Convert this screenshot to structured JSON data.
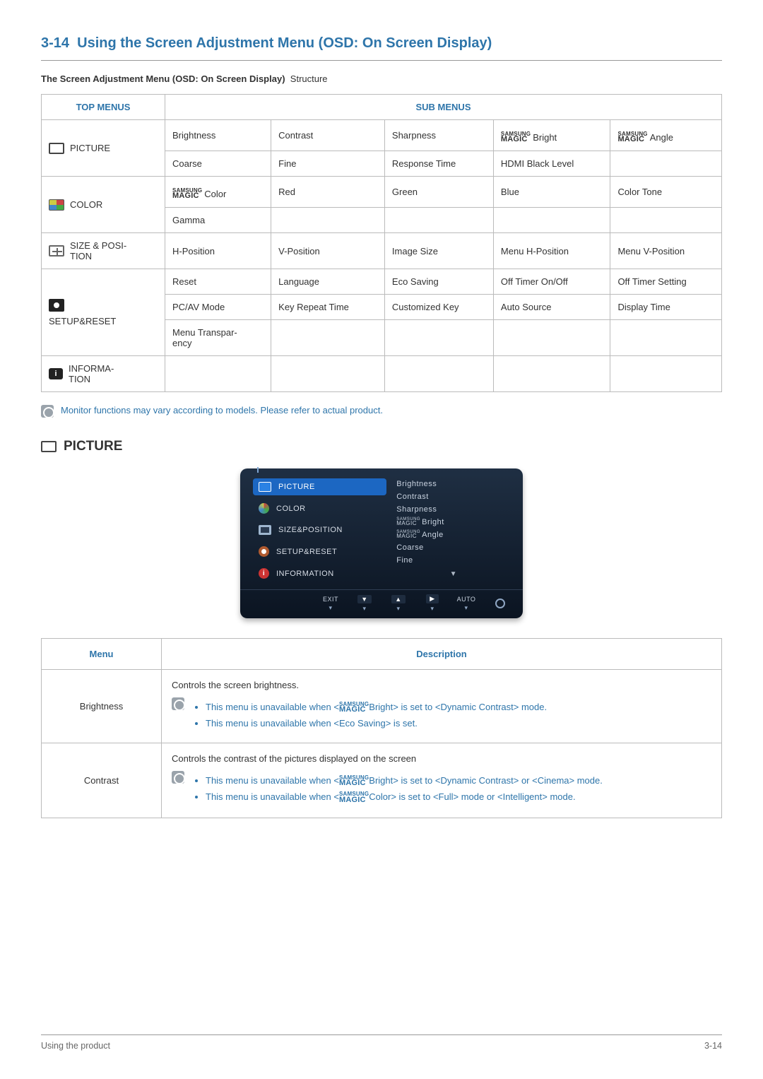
{
  "page": {
    "section_number": "3-14",
    "title": "Using the Screen Adjustment Menu (OSD: On Screen Display)",
    "subtitle_bold": "The Screen Adjustment Menu (OSD: On Screen Display)",
    "subtitle_rest": "Structure",
    "footer_left": "Using the product",
    "footer_right": "3-14"
  },
  "brand": {
    "samsung": "SAMSUNG",
    "magic": "MAGIC"
  },
  "top_table": {
    "header_left": "TOP MENUS",
    "header_right": "SUB MENUS",
    "rows": [
      {
        "menu": "PICTURE",
        "icon": "rect",
        "cells": [
          [
            "Brightness",
            "Contrast",
            "Sharpness",
            "{MAGIC} Bright",
            "{MAGIC} Angle"
          ],
          [
            "Coarse",
            "Fine",
            "Response Time",
            "HDMI Black Level",
            ""
          ]
        ]
      },
      {
        "menu": "COLOR",
        "icon": "color",
        "cells": [
          [
            "{MAGIC}Color",
            "Red",
            "Green",
            "Blue",
            "Color Tone"
          ],
          [
            "Gamma",
            "",
            "",
            "",
            ""
          ]
        ]
      },
      {
        "menu": "SIZE & POSI-TION",
        "icon": "sizepos",
        "cells": [
          [
            "H-Position",
            "V-Position",
            "Image Size",
            "Menu H-Position",
            "Menu V-Position"
          ]
        ]
      },
      {
        "menu": "SETUP&RESET",
        "icon": "gear",
        "cells": [
          [
            "Reset",
            "Language",
            "Eco Saving",
            "Off Timer On/Off",
            "Off Timer Setting"
          ],
          [
            "PC/AV Mode",
            "Key Repeat Time",
            "Customized Key",
            "Auto Source",
            "Display Time"
          ],
          [
            "Menu Transpar-ency",
            "",
            "",
            "",
            ""
          ]
        ]
      },
      {
        "menu": "INFORMA-TION",
        "icon": "info",
        "cells": [
          [
            "",
            "",
            "",
            "",
            ""
          ]
        ]
      }
    ]
  },
  "tip_text": "Monitor functions may vary according to models. Please refer to actual product.",
  "picture_section": {
    "header": "PICTURE",
    "osd_left": [
      "PICTURE",
      "COLOR",
      "SIZE&POSITION",
      "SETUP&RESET",
      "INFORMATION"
    ],
    "osd_right": [
      "Brightness",
      "Contrast",
      "Sharpness",
      "{MINI}Bright",
      "{MINI}Angle",
      "Coarse",
      "Fine"
    ],
    "osd_bar": {
      "exit": "EXIT",
      "auto": "AUTO"
    }
  },
  "desc_table": {
    "header_menu": "Menu",
    "header_desc": "Description",
    "rows": [
      {
        "menu": "Brightness",
        "lead": "Controls the screen brightness.",
        "bullets": [
          "This menu is unavailable when <{MAGIC}Bright> is set to <Dynamic Contrast> mode.",
          "This menu is unavailable when <Eco Saving> is set."
        ]
      },
      {
        "menu": "Contrast",
        "lead": "Controls the contrast of the pictures displayed on the screen",
        "bullets": [
          "This menu is unavailable when <{MAGIC}Bright> is set to <Dynamic Contrast> or <Cinema> mode.",
          "This menu is unavailable when <{MAGIC}Color> is set to <Full> mode or <Intelligent> mode."
        ]
      }
    ]
  }
}
